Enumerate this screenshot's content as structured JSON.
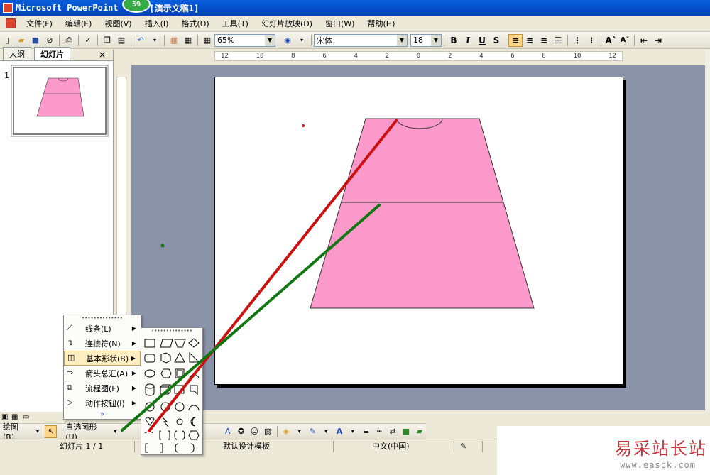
{
  "window": {
    "title": "Microsoft PowerPoint",
    "doc_title": "[演示文稿1]",
    "badge": "59"
  },
  "menus": [
    {
      "label": "文件(F)"
    },
    {
      "label": "编辑(E)"
    },
    {
      "label": "视图(V)"
    },
    {
      "label": "插入(I)"
    },
    {
      "label": "格式(O)"
    },
    {
      "label": "工具(T)"
    },
    {
      "label": "幻灯片放映(D)"
    },
    {
      "label": "窗口(W)"
    },
    {
      "label": "帮助(H)"
    }
  ],
  "toolbar": {
    "zoom": "65%",
    "font": "宋体",
    "font_size": "18",
    "bold": "B",
    "italic": "I",
    "underline": "U",
    "shadow": "S"
  },
  "left_pane": {
    "tab_outline": "大纲",
    "tab_slides": "幻灯片",
    "close": "×",
    "slide_number": "1"
  },
  "ruler": {
    "ticks": [
      "12",
      "10",
      "8",
      "6",
      "4",
      "2",
      "0",
      "2",
      "4",
      "6",
      "8",
      "10",
      "12"
    ]
  },
  "autoshape_menu": {
    "grip": "••••••••••••••",
    "items": [
      {
        "label": "线条(L)"
      },
      {
        "label": "连接符(N)"
      },
      {
        "label": "基本形状(B)"
      },
      {
        "label": "箭头总汇(A)"
      },
      {
        "label": "流程图(F)"
      },
      {
        "label": "动作按钮(I)"
      }
    ],
    "more": "»"
  },
  "drawing_toolbar": {
    "draw_label": "绘图(R)",
    "autoshapes_label": "自选图形(U)"
  },
  "statusbar": {
    "slide_info": "幻灯片 1 / 1",
    "template": "默认设计模板",
    "language": "中文(中国)"
  },
  "watermark": {
    "cn": "易采站长站",
    "url": "www.easck.com"
  },
  "colors": {
    "shape_fill": "#fc99cb",
    "red_line": "#cc1111",
    "green_line": "#117711",
    "workspace": "#8b93a8"
  }
}
